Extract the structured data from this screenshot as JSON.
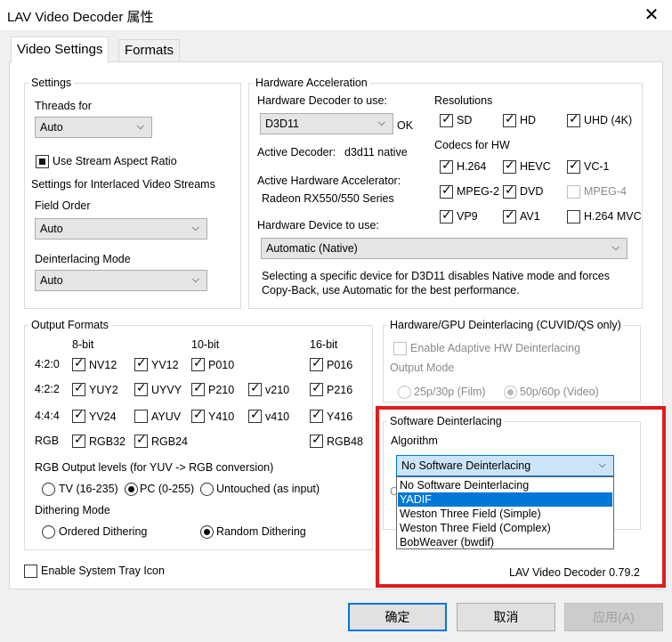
{
  "window": {
    "title": "LAV Video Decoder 属性",
    "close_symbol": "✕"
  },
  "tabs": [
    {
      "label": "Video Settings",
      "active": true
    },
    {
      "label": "Formats",
      "active": false
    }
  ],
  "settings": {
    "group_label": "Settings",
    "threads_label": "Threads for",
    "threads_value": "Auto",
    "stream_aspect_label": "Use Stream Aspect Ratio",
    "interlaced_label": "Settings for Interlaced Video Streams",
    "field_order_label": "Field Order",
    "field_order_value": "Auto",
    "deint_mode_label": "Deinterlacing Mode",
    "deint_mode_value": "Auto"
  },
  "hw": {
    "group_label": "Hardware Acceleration",
    "decoder_label": "Hardware Decoder to use:",
    "decoder_value": "D3D11",
    "ok_label": "OK",
    "active_decoder_label": "Active Decoder:",
    "active_decoder_value": "d3d11 native",
    "active_accel_label": "Active Hardware Accelerator:",
    "active_accel_value": "Radeon RX550/550 Series",
    "device_label": "Hardware Device to use:",
    "device_value": "Automatic (Native)",
    "note": "Selecting a specific device for D3D11 disables Native mode and forces Copy-Back, use Automatic for the best performance.",
    "resolutions_label": "Resolutions",
    "resolutions": [
      {
        "label": "SD",
        "checked": true
      },
      {
        "label": "HD",
        "checked": true
      },
      {
        "label": "UHD (4K)",
        "checked": true
      }
    ],
    "codecs_label": "Codecs for HW",
    "codecs": [
      {
        "label": "H.264",
        "checked": true,
        "enabled": true
      },
      {
        "label": "HEVC",
        "checked": true,
        "enabled": true
      },
      {
        "label": "VC-1",
        "checked": true,
        "enabled": true
      },
      {
        "label": "MPEG-2",
        "checked": true,
        "enabled": true
      },
      {
        "label": "DVD",
        "checked": true,
        "enabled": true
      },
      {
        "label": "MPEG-4",
        "checked": false,
        "enabled": false
      },
      {
        "label": "VP9",
        "checked": true,
        "enabled": true
      },
      {
        "label": "AV1",
        "checked": true,
        "enabled": true
      },
      {
        "label": "H.264 MVC",
        "checked": false,
        "enabled": true
      }
    ]
  },
  "output": {
    "group_label": "Output Formats",
    "col_headers": [
      "8-bit",
      "10-bit",
      "16-bit"
    ],
    "row_labels": [
      "4:2:0",
      "4:2:2",
      "4:4:4",
      "RGB"
    ],
    "formats": {
      "nv12": {
        "label": "NV12",
        "checked": true
      },
      "yv12": {
        "label": "YV12",
        "checked": true
      },
      "p010": {
        "label": "P010",
        "checked": true
      },
      "p016": {
        "label": "P016",
        "checked": true
      },
      "yuy2": {
        "label": "YUY2",
        "checked": true
      },
      "uyvy": {
        "label": "UYVY",
        "checked": true
      },
      "p210": {
        "label": "P210",
        "checked": true
      },
      "v210": {
        "label": "v210",
        "checked": true
      },
      "p216": {
        "label": "P216",
        "checked": true
      },
      "yv24": {
        "label": "YV24",
        "checked": true
      },
      "ayuv": {
        "label": "AYUV",
        "checked": false
      },
      "y410": {
        "label": "Y410",
        "checked": true
      },
      "v410": {
        "label": "v410",
        "checked": true
      },
      "y416": {
        "label": "Y416",
        "checked": true
      },
      "rgb32": {
        "label": "RGB32",
        "checked": true
      },
      "rgb24": {
        "label": "RGB24",
        "checked": true
      },
      "rgb48": {
        "label": "RGB48",
        "checked": true
      }
    },
    "rgb_levels_label": "RGB Output levels (for YUV -> RGB conversion)",
    "rgb_levels": [
      {
        "label": "TV (16-235)",
        "selected": false
      },
      {
        "label": "PC (0-255)",
        "selected": true
      },
      {
        "label": "Untouched (as input)",
        "selected": false
      }
    ],
    "dithering_label": "Dithering Mode",
    "dithering": [
      {
        "label": "Ordered Dithering",
        "selected": false
      },
      {
        "label": "Random Dithering",
        "selected": true
      }
    ]
  },
  "hw_deint": {
    "group_label": "Hardware/GPU Deinterlacing (CUVID/QS only)",
    "adaptive_label": "Enable Adaptive HW Deinterlacing",
    "output_mode_label": "Output Mode",
    "modes": [
      {
        "label": "25p/30p (Film)",
        "selected": false
      },
      {
        "label": "50p/60p (Video)",
        "selected": true
      }
    ]
  },
  "sw_deint": {
    "group_label": "Software Deinterlacing",
    "algorithm_label": "Algorithm",
    "algorithm_value": "No Software Deinterlacing",
    "options": [
      "No Software Deinterlacing",
      "YADIF",
      "Weston Three Field (Simple)",
      "Weston Three Field (Complex)",
      "BobWeaver (bwdif)"
    ],
    "highlighted_index": 1,
    "hidden_radio_glyph": "O"
  },
  "tray_icon_label": "Enable System Tray Icon",
  "version": "LAV Video Decoder 0.79.2",
  "buttons": {
    "ok": "确定",
    "cancel": "取消",
    "apply": "应用(A)"
  },
  "colors": {
    "highlight": "#0078d7",
    "annotation_red": "#e21b1b"
  },
  "icons": {
    "chevron": "⌵",
    "check": "✓"
  }
}
